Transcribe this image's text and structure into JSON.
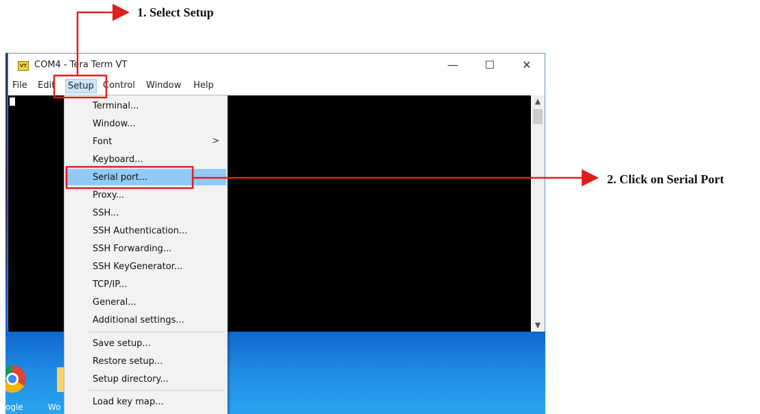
{
  "annotations": {
    "step1": "1. Select  Setup",
    "step2": "2. Click on Serial Port"
  },
  "window": {
    "title": "COM4 - Tera Term VT",
    "icon_label": "VT",
    "controls": {
      "minimize": "—",
      "maximize": "☐",
      "close": "✕"
    }
  },
  "menubar": [
    "File",
    "Edit",
    "Setup",
    "Control",
    "Window",
    "Help"
  ],
  "setup_menu": [
    "Terminal...",
    "Window...",
    "Font",
    "Keyboard...",
    "Serial port...",
    "Proxy...",
    "SSH...",
    "SSH Authentication...",
    "SSH Forwarding...",
    "SSH KeyGenerator...",
    "TCP/IP...",
    "General...",
    "Additional settings...",
    "Save setup...",
    "Restore setup...",
    "Setup directory...",
    "Load key map..."
  ],
  "submenu_arrow": ">",
  "desktop": {
    "labels": [
      "ogle",
      "Wo"
    ]
  },
  "icons": [
    "app-icon",
    "chrome-icon",
    "folder-icon",
    "submenu-arrow-icon",
    "scroll-up-icon",
    "scroll-down-icon"
  ],
  "colors": {
    "highlight_box": "#e01e1e",
    "menu_highlight": "#91c9f7",
    "terminal_bg": "#000000",
    "desktop": "#1a6fd1"
  }
}
